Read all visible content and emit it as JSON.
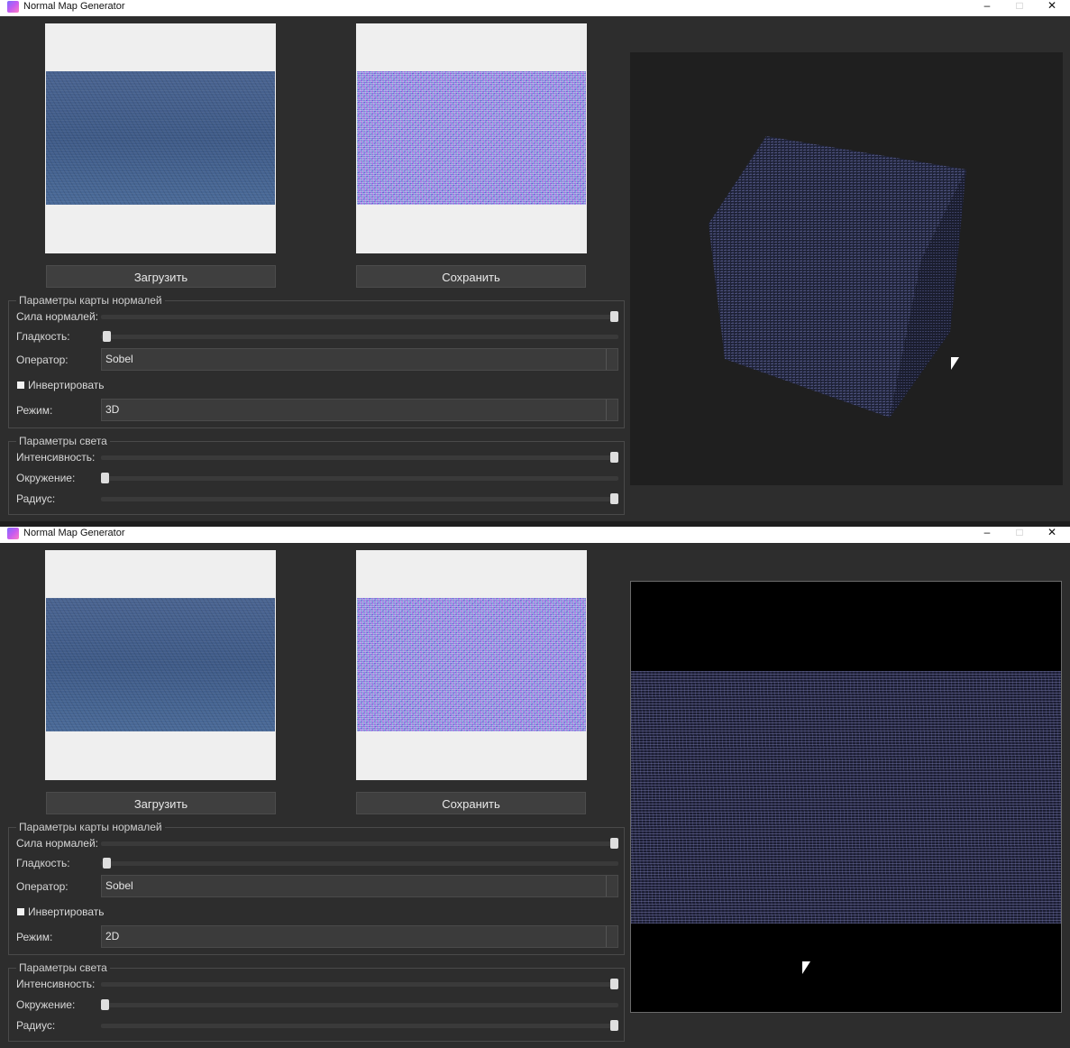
{
  "windows": [
    {
      "title": "Normal Map Generator",
      "buttons": {
        "load": "Загрузить",
        "save": "Сохранить"
      },
      "normal_group": {
        "title": "Параметры карты нормалей",
        "strength_label": "Сила нормалей:",
        "smooth_label": "Гладкость:",
        "operator_label": "Оператор:",
        "operator_value": "Sobel",
        "invert_label": "Инвертировать",
        "mode_label": "Режим:",
        "mode_value": "3D"
      },
      "light_group": {
        "title": "Параметры света",
        "intensity_label": "Интенсивность:",
        "ambient_label": "Окружение:",
        "radius_label": "Радиус:"
      },
      "slider_levels": {
        "strength": 1.0,
        "smooth": 0.0,
        "intensity": 1.0,
        "ambient": 0.0,
        "radius": 1.0
      },
      "viewport": "cube"
    },
    {
      "title": "Normal Map Generator",
      "buttons": {
        "load": "Загрузить",
        "save": "Сохранить"
      },
      "normal_group": {
        "title": "Параметры карты нормалей",
        "strength_label": "Сила нормалей:",
        "smooth_label": "Гладкость:",
        "operator_label": "Оператор:",
        "operator_value": "Sobel",
        "invert_label": "Инвертировать",
        "mode_label": "Режим:",
        "mode_value": "2D"
      },
      "light_group": {
        "title": "Параметры света",
        "intensity_label": "Интенсивность:",
        "ambient_label": "Окружение:",
        "radius_label": "Радиус:"
      },
      "slider_levels": {
        "strength": 1.0,
        "smooth": 0.0,
        "intensity": 1.0,
        "ambient": 0.0,
        "radius": 1.0
      },
      "viewport": "plane"
    }
  ],
  "icons": {
    "minimize": "minimize-icon",
    "maximize": "maximize-icon",
    "close": "close-icon",
    "app": "app-icon"
  }
}
